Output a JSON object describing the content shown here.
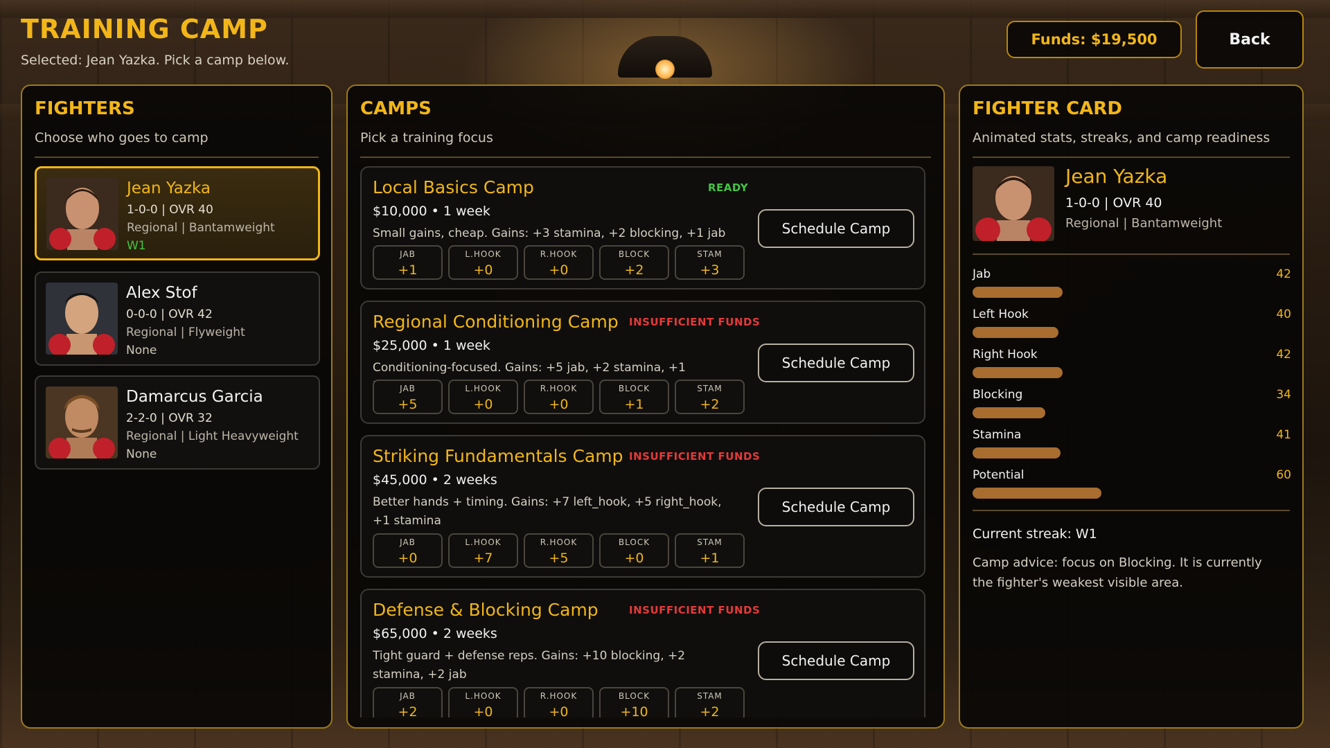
{
  "header": {
    "title": "TRAINING CAMP",
    "subtitle": "Selected: Jean Yazka. Pick a camp below.",
    "funds": "Funds: $19,500",
    "back_label": "Back"
  },
  "fighters_panel": {
    "title": "FIGHTERS",
    "subtitle": "Choose who goes to camp",
    "items": [
      {
        "name": "Jean Yazka",
        "record": "1-0-0  |  OVR 40",
        "division": "Regional  |  Bantamweight",
        "streak": "W1",
        "selected": true
      },
      {
        "name": "Alex Stof",
        "record": "0-0-0  |  OVR 42",
        "division": "Regional  |  Flyweight",
        "streak": "None",
        "selected": false
      },
      {
        "name": "Damarcus Garcia",
        "record": "2-2-0  |  OVR 32",
        "division": "Regional  |  Light Heavyweight",
        "streak": "None",
        "selected": false
      }
    ]
  },
  "camps_panel": {
    "title": "CAMPS",
    "subtitle": "Pick a training focus",
    "button_label": "Schedule Camp",
    "stat_labels": [
      "JAB",
      "L.HOOK",
      "R.HOOK",
      "BLOCK",
      "STAM"
    ],
    "items": [
      {
        "name": "Local Basics Camp",
        "status": "READY",
        "cost": "$10,000  •  1 week",
        "description": "Small gains, cheap. Gains: +3 stamina, +2 blocking, +1 jab",
        "gains": [
          "+1",
          "+0",
          "+0",
          "+2",
          "+3"
        ]
      },
      {
        "name": "Regional Conditioning Camp",
        "status": "INSUFFICIENT FUNDS",
        "cost": "$25,000  •  1 week",
        "description": "Conditioning-focused. Gains: +5 jab, +2 stamina, +1 blocking",
        "gains": [
          "+5",
          "+0",
          "+0",
          "+1",
          "+2"
        ]
      },
      {
        "name": "Striking Fundamentals Camp",
        "status": "INSUFFICIENT FUNDS",
        "cost": "$45,000  •  2 weeks",
        "description": "Better hands + timing. Gains: +7 left_hook, +5 right_hook, +1 stamina",
        "gains": [
          "+0",
          "+7",
          "+5",
          "+0",
          "+1"
        ]
      },
      {
        "name": "Defense & Blocking Camp",
        "status": "INSUFFICIENT FUNDS",
        "cost": "$65,000  •  2 weeks",
        "description": "Tight guard + defense reps. Gains: +10 blocking, +2 stamina, +2 jab",
        "gains": [
          "+2",
          "+0",
          "+0",
          "+10",
          "+2"
        ]
      }
    ]
  },
  "fighter_card": {
    "title": "FIGHTER CARD",
    "subtitle": "Animated stats, streaks, and camp readiness",
    "name": "Jean Yazka",
    "record": "1-0-0  |  OVR 40",
    "division": "Regional  |  Bantamweight",
    "stats": [
      {
        "label": "Jab",
        "value": 42
      },
      {
        "label": "Left Hook",
        "value": 40
      },
      {
        "label": "Right Hook",
        "value": 42
      },
      {
        "label": "Blocking",
        "value": 34
      },
      {
        "label": "Stamina",
        "value": 41
      },
      {
        "label": "Potential",
        "value": 60
      }
    ],
    "streak": "Current streak: W1",
    "advice": "Camp advice: focus on Blocking. It is currently the fighter's weakest visible area."
  },
  "colors": {
    "accent": "#f2b619",
    "ready": "#43c443",
    "insufficient": "#e33a3a",
    "bar": "#a86d2f"
  }
}
